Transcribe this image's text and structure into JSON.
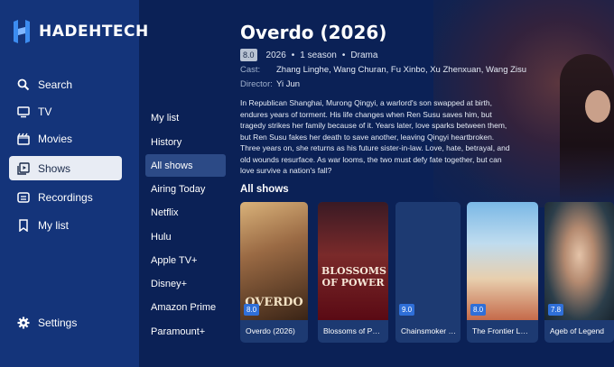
{
  "app": {
    "name": "HADEHTECH"
  },
  "nav": {
    "items": [
      {
        "label": "Search",
        "icon": "search-icon"
      },
      {
        "label": "TV",
        "icon": "tv-icon"
      },
      {
        "label": "Movies",
        "icon": "clapper-icon"
      },
      {
        "label": "Shows",
        "icon": "play-stack-icon",
        "active": true
      },
      {
        "label": "Recordings",
        "icon": "recording-icon"
      },
      {
        "label": "My list",
        "icon": "bookmark-icon"
      }
    ],
    "settings_label": "Settings"
  },
  "submenu": {
    "items": [
      "My list",
      "History",
      "All shows",
      "Airing Today",
      "Netflix",
      "Hulu",
      "Apple TV+",
      "Disney+",
      "Amazon Prime",
      "Paramount+"
    ],
    "active": "All shows"
  },
  "details": {
    "title": "Overdo (2026)",
    "rating": "8.0",
    "year": "2026",
    "seasons": "1 season",
    "genre": "Drama",
    "cast_label": "Cast:",
    "cast": "Zhang Linghe, Wang Churan, Fu Xinbo, Xu Zhenxuan, Wang Zisu",
    "director_label": "Director:",
    "director": "Yi Jun",
    "synopsis": "In Republican Shanghai, Murong Qingyi, a warlord's son swapped at birth, endures years of torment. His life changes when Ren Susu saves him, but tragedy strikes her family because of it. Years later, love sparks between them, but Ren Susu fakes her death to save another, leaving Qingyi heartbroken. Three years on, she returns as his future sister-in-law. Love, hate, betrayal, and old wounds resurface. As war looms, the two must defy fate together, but can love survive a nation's fall?"
  },
  "shows_section": {
    "title": "All shows",
    "cards": [
      {
        "name": "Overdo (2026)",
        "rating": "8.0",
        "poster_text": "OVERDO"
      },
      {
        "name": "Blossoms of Pow…",
        "rating": "",
        "poster_text": "BLOSSOMS OF POWER"
      },
      {
        "name": "Chainsmoker Cat…",
        "rating": "9.0",
        "poster_text": ""
      },
      {
        "name": "The Frontier Lord…",
        "rating": "8.0",
        "poster_text": ""
      },
      {
        "name": "Ageb of Legend",
        "rating": "7.8",
        "poster_text": ""
      }
    ]
  },
  "colors": {
    "background": "#0b2156",
    "sidebar": "#14347a",
    "accent_badge": "#2f6fd8",
    "active_nav": "#e8ecf4"
  }
}
